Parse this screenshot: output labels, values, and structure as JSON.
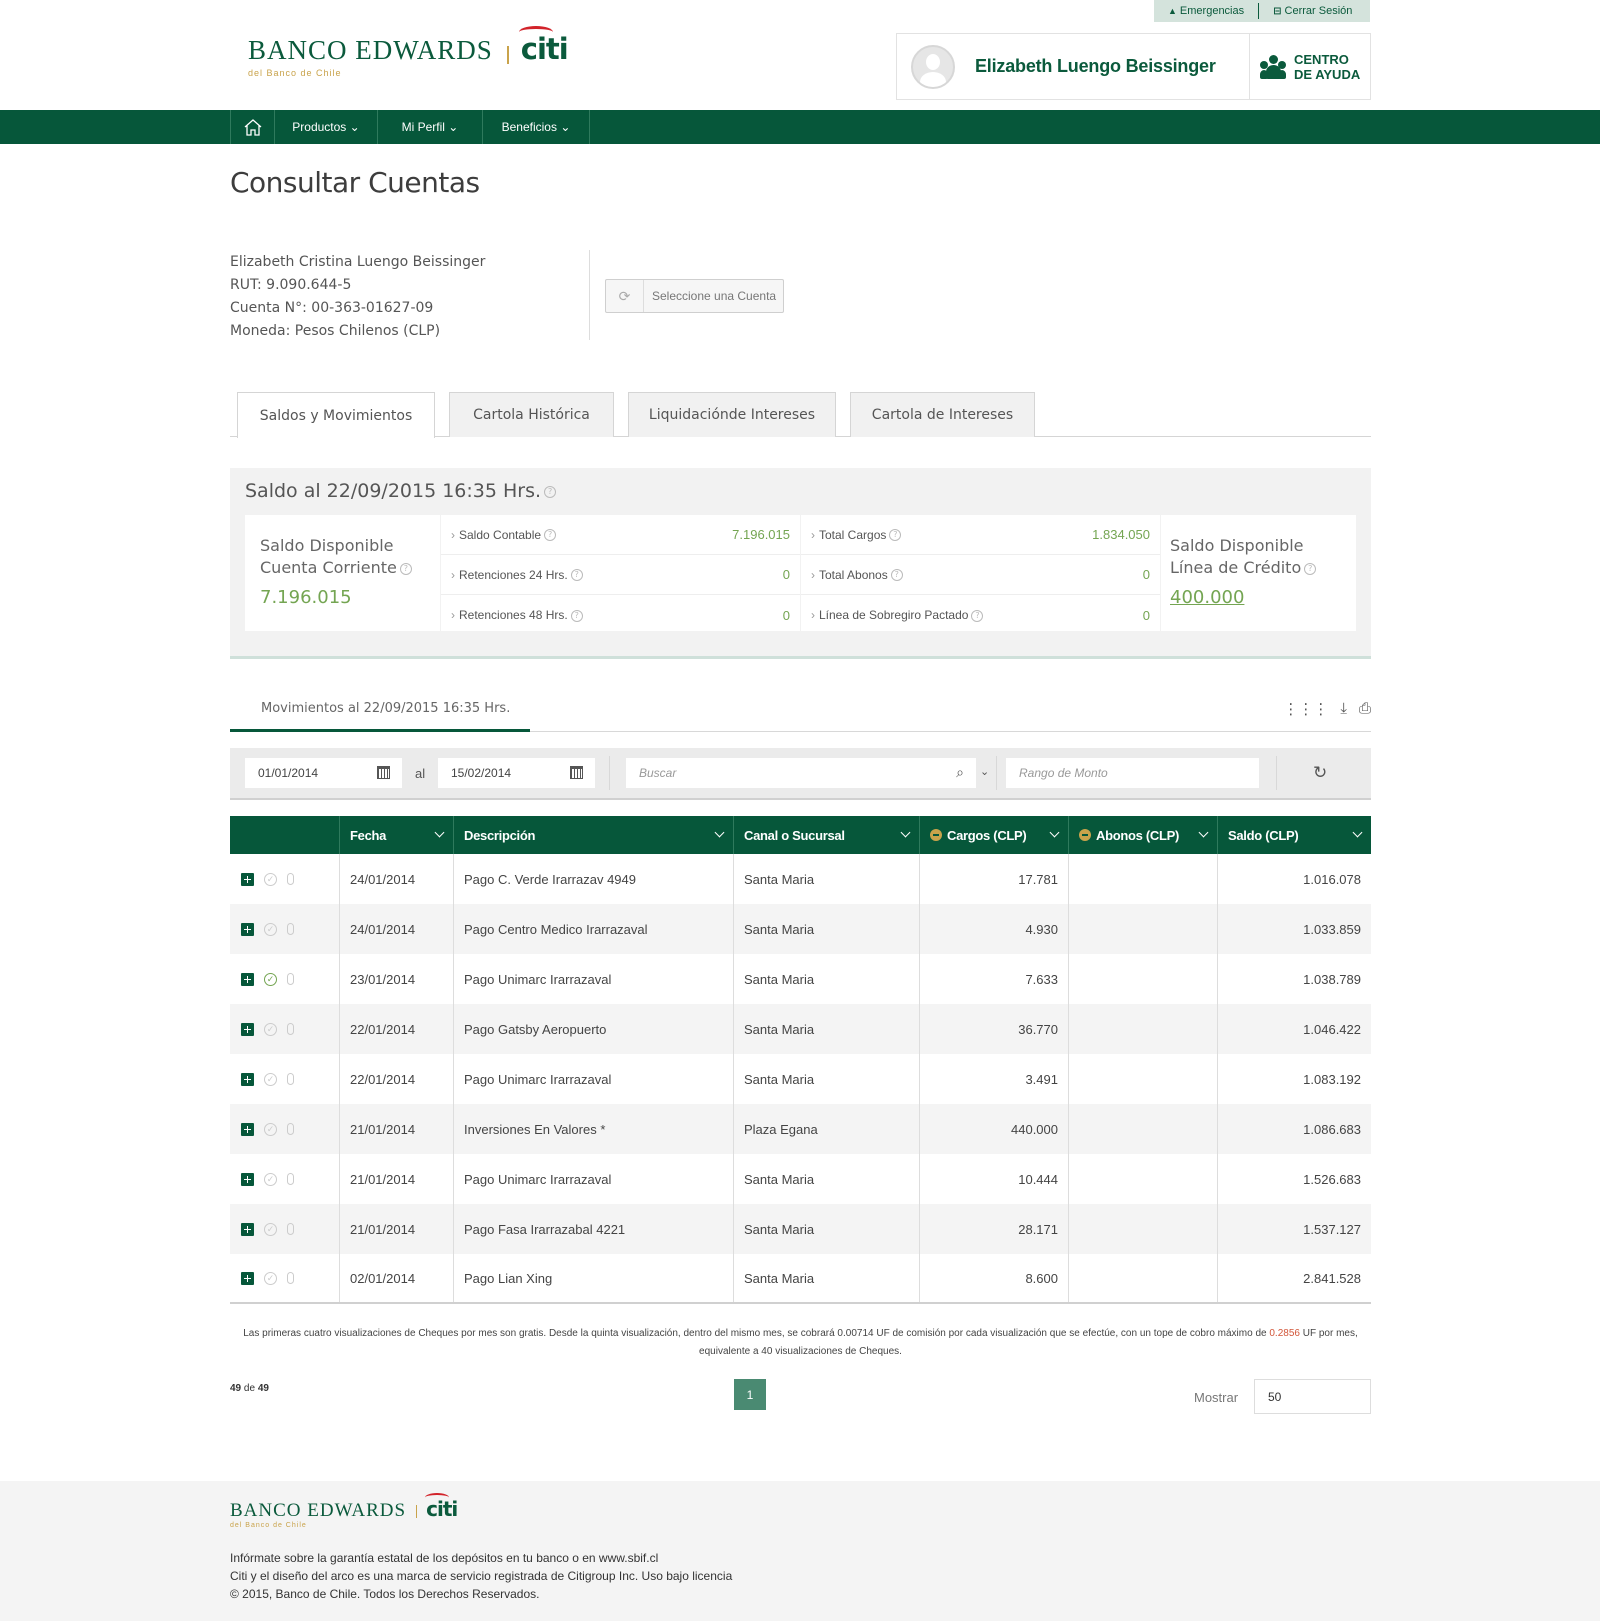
{
  "top_links": {
    "emergencias": "Emergencias",
    "cerrar_sesion": "Cerrar Sesión"
  },
  "brand": {
    "name": "BANCO EDWARDS",
    "partner": "citi",
    "tagline": "del Banco de Chile"
  },
  "user": {
    "name": "Elizabeth Luengo Beissinger",
    "help_line1": "CENTRO",
    "help_line2": "DE AYUDA"
  },
  "nav": {
    "productos": "Productos",
    "mi_perfil": "Mi Perfil",
    "beneficios": "Beneficios"
  },
  "page_title": "Consultar Cuentas",
  "account": {
    "holder": "Elizabeth Cristina Luengo Beissinger",
    "rut": "RUT: 9.090.644-5",
    "cuenta": "Cuenta N°: 00-363-01627-09",
    "moneda": "Moneda: Pesos Chilenos (CLP)",
    "select_label": "Seleccione una Cuenta"
  },
  "tabs": [
    "Saldos y Movimientos",
    "Cartola Histórica",
    "Liquidaciónde Intereses",
    "Cartola de Intereses"
  ],
  "saldo": {
    "title": "Saldo al 22/09/2015 16:35 Hrs.",
    "disponible_cc_l1": "Saldo Disponible",
    "disponible_cc_l2": "Cuenta Corriente",
    "disponible_cc_value": "7.196.015",
    "rows_left": [
      {
        "label": "Saldo Contable",
        "value": "7.196.015"
      },
      {
        "label": "Retenciones 24 Hrs.",
        "value": "0"
      },
      {
        "label": "Retenciones 48 Hrs.",
        "value": "0"
      }
    ],
    "rows_right": [
      {
        "label": "Total Cargos",
        "value": "1.834.050"
      },
      {
        "label": "Total Abonos",
        "value": "0"
      },
      {
        "label": "Línea de Sobregiro Pactado",
        "value": "0"
      }
    ],
    "disponible_lc_l1": "Saldo Disponible",
    "disponible_lc_l2": "Línea de Crédito",
    "disponible_lc_value": "400.000"
  },
  "movimientos": {
    "title": "Movimientos al 22/09/2015 16:35 Hrs.",
    "date_from": "01/01/2014",
    "date_sep": "al",
    "date_to": "15/02/2014",
    "search_placeholder": "Buscar",
    "monto_placeholder": "Rango de Monto"
  },
  "table": {
    "headers": [
      "Fecha",
      "Descripción",
      "Canal o Sucursal",
      "Cargos (CLP)",
      "Abonos (CLP)",
      "Saldo (CLP)"
    ],
    "rows": [
      {
        "fecha": "24/01/2014",
        "desc": "Pago C. Verde Irarrazav 4949",
        "canal": "Santa Maria",
        "cargo": "17.781",
        "abono": "",
        "saldo": "1.016.078",
        "checked": false
      },
      {
        "fecha": "24/01/2014",
        "desc": "Pago Centro Medico Irarrazaval",
        "canal": "Santa Maria",
        "cargo": "4.930",
        "abono": "",
        "saldo": "1.033.859",
        "checked": false
      },
      {
        "fecha": "23/01/2014",
        "desc": "Pago Unimarc Irarrazaval",
        "canal": "Santa Maria",
        "cargo": "7.633",
        "abono": "",
        "saldo": "1.038.789",
        "checked": true
      },
      {
        "fecha": "22/01/2014",
        "desc": "Pago Gatsby Aeropuerto",
        "canal": "Santa Maria",
        "cargo": "36.770",
        "abono": "",
        "saldo": "1.046.422",
        "checked": false
      },
      {
        "fecha": "22/01/2014",
        "desc": "Pago Unimarc Irarrazaval",
        "canal": "Santa Maria",
        "cargo": "3.491",
        "abono": "",
        "saldo": "1.083.192",
        "checked": false
      },
      {
        "fecha": "21/01/2014",
        "desc": "Inversiones En Valores *",
        "canal": "Plaza Egana",
        "cargo": "440.000",
        "abono": "",
        "saldo": "1.086.683",
        "checked": false
      },
      {
        "fecha": "21/01/2014",
        "desc": "Pago Unimarc Irarrazaval",
        "canal": "Santa Maria",
        "cargo": "10.444",
        "abono": "",
        "saldo": "1.526.683",
        "checked": false
      },
      {
        "fecha": "21/01/2014",
        "desc": "Pago Fasa Irarrazabal 4221",
        "canal": "Santa Maria",
        "cargo": "28.171",
        "abono": "",
        "saldo": "1.537.127",
        "checked": false
      },
      {
        "fecha": "02/01/2014",
        "desc": "Pago Lian Xing",
        "canal": "Santa Maria",
        "cargo": "8.600",
        "abono": "",
        "saldo": "2.841.528",
        "checked": false
      }
    ]
  },
  "note": {
    "part1": "Las primeras cuatro visualizaciones de Cheques por mes son gratis. Desde la quinta visualización, dentro del mismo mes, se cobrará 0.00714 UF de comisión por cada visualización que se efectúe, con un tope de cobro máximo de",
    "highlight": "0.2856",
    "part2": "UF por mes, equivalente a 40 visualizaciones de Cheques."
  },
  "pagination": {
    "shown": "49",
    "de": "de",
    "total": "49",
    "current_page": "1",
    "mostrar_label": "Mostrar",
    "mostrar_value": "50"
  },
  "footer": {
    "line1": "Infórmate sobre la garantía estatal de los depósitos en tu banco o en www.sbif.cl",
    "line2": "Citi y el diseño del arco es una marca de servicio registrada de Citigroup Inc. Uso bajo licencia",
    "line3": "© 2015, Banco de Chile. Todos los Derechos Reservados."
  },
  "colors": {
    "brand_green": "#06573a",
    "value_green": "#74a552",
    "gold": "#c9a34b",
    "citi_red": "#d2232a"
  },
  "icons": [
    "home-icon",
    "warning-icon",
    "logout-icon",
    "help-people-icon",
    "refresh-account-icon",
    "question-icon",
    "columns-icon",
    "download-icon",
    "print-icon",
    "calendar-icon",
    "search-icon",
    "reload-icon",
    "expand-plus-icon",
    "check-icon",
    "attachment-icon"
  ]
}
